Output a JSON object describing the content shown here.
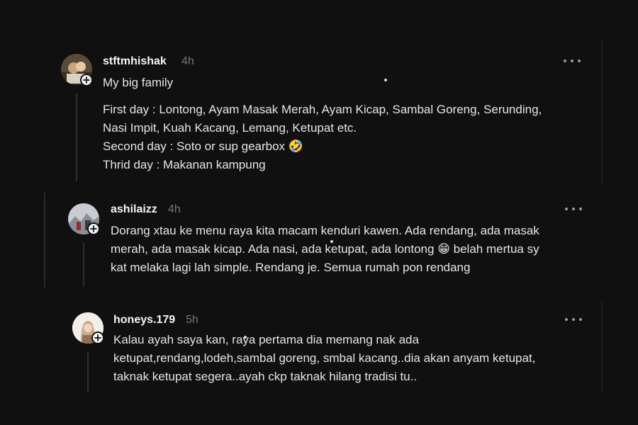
{
  "posts": [
    {
      "username": "stftmhishak",
      "time": "4h",
      "lines": [
        "My big family",
        "",
        "First day : Lontong, Ayam Masak Merah, Ayam Kicap, Sambal Goreng, Serunding,",
        "Nasi Impit, Kuah Kacang, Lemang, Ketupat etc.",
        "Second day : Soto or sup gearbox 🤣",
        "Thrid day : Makanan kampung"
      ]
    },
    {
      "username": "ashilaizz",
      "time": "4h",
      "lines": [
        "Dorang xtau ke menu raya kita macam kenduri kawen. Ada rendang, ada masak",
        "merah, ada masak kicap. Ada nasi, ada ketupat, ada lontong 😁 belah mertua sy",
        "kat melaka lagi lah simple. Rendang je. Semua rumah pon rendang"
      ]
    },
    {
      "username": "honeys.179",
      "time": "5h",
      "lines": [
        "Kalau ayah saya kan, raya pertama dia memang nak ada",
        "ketupat,rendang,lodeh,sambal goreng, smbal kacang..dia akan anyam ketupat,",
        "taknak ketupat segera..ayah ckp taknak hilang tradisi tu.."
      ]
    }
  ],
  "icons": {
    "more": "more-horizontal-icon",
    "follow": "plus-icon"
  }
}
